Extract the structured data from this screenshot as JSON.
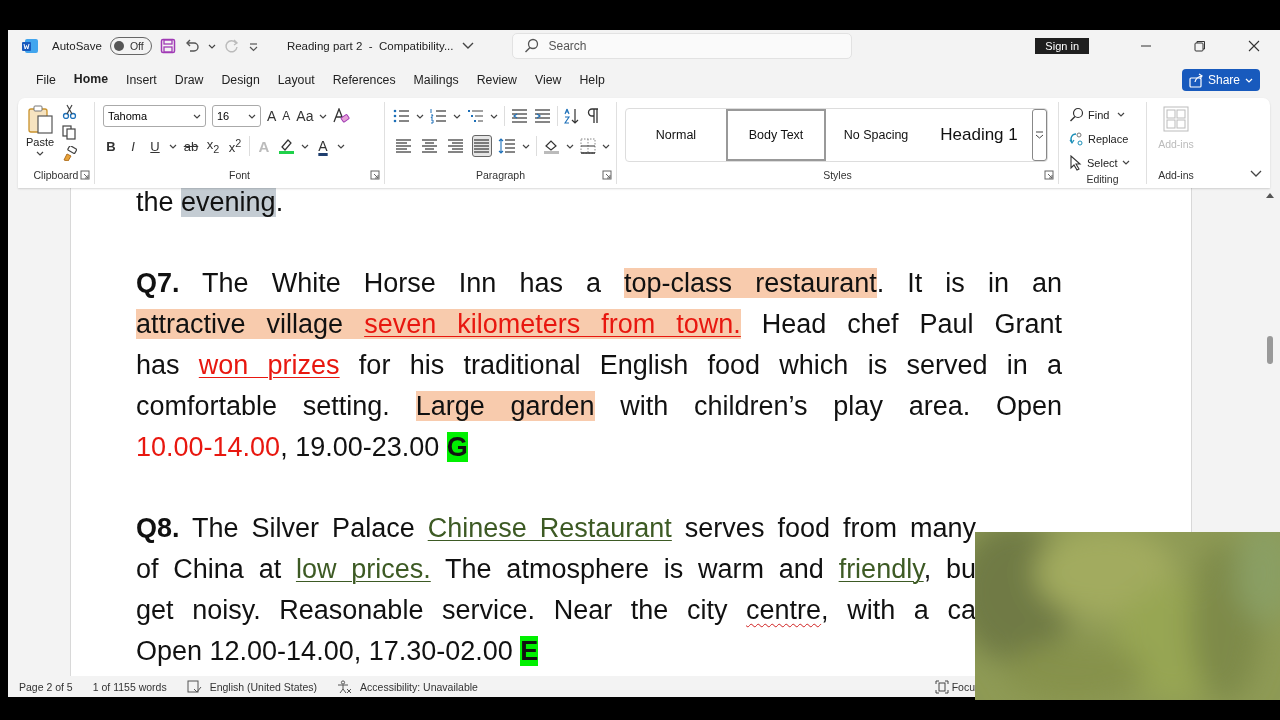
{
  "title_bar": {
    "autosave_label": "AutoSave",
    "autosave": {
      "label": "Off",
      "on": false
    },
    "document_title": "Reading part 2  -  Compatibility...",
    "search": {
      "placeholder": "Search"
    },
    "sign_in": "Sign in"
  },
  "menu_tabs": [
    {
      "label": "File",
      "selected": false
    },
    {
      "label": "Home",
      "selected": true
    },
    {
      "label": "Insert",
      "selected": false
    },
    {
      "label": "Draw",
      "selected": false
    },
    {
      "label": "Design",
      "selected": false
    },
    {
      "label": "Layout",
      "selected": false
    },
    {
      "label": "References",
      "selected": false
    },
    {
      "label": "Mailings",
      "selected": false
    },
    {
      "label": "Review",
      "selected": false
    },
    {
      "label": "View",
      "selected": false
    },
    {
      "label": "Help",
      "selected": false
    }
  ],
  "share": "Share",
  "ribbon": {
    "clipboard": {
      "paste": "Paste",
      "label": "Clipboard"
    },
    "font": {
      "font_name": "Tahoma",
      "font_size": "16",
      "grow": "A",
      "shrink": "A",
      "change_case": "Aa",
      "format_buttons": [
        "B",
        "I",
        "U",
        "ab",
        "x$_{2}$",
        "x$^{2}$"
      ],
      "text_effects": "A",
      "font_color": "A",
      "label": "Font"
    },
    "paragraph": {
      "alignments": [
        {
          "selected": false
        },
        {
          "selected": false
        },
        {
          "selected": false
        },
        {
          "selected": true
        }
      ],
      "label": "Paragraph"
    },
    "styles": {
      "items": [
        {
          "label": "Normal",
          "kind": "normal",
          "selected": false
        },
        {
          "label": "Body Text",
          "kind": "normal",
          "selected": true
        },
        {
          "label": "No Spacing",
          "kind": "normal",
          "selected": false
        },
        {
          "label": "Heading 1",
          "kind": "heading",
          "selected": false
        }
      ],
      "label": "Styles"
    },
    "editing": {
      "find": "Find",
      "replace": "Replace",
      "select": "Select",
      "label": "Editing"
    },
    "addins": {
      "button": {
        "label": "Add-ins",
        "disabled": true
      },
      "label": "Add-ins"
    }
  },
  "document": {
    "paragraphs": [
      {
        "lines": [
          [
            {
              "text": "the ",
              "kind": "plain"
            },
            {
              "text": "evening",
              "kind": "gray-highlight"
            },
            {
              "text": ".",
              "kind": "plain"
            }
          ]
        ]
      },
      {
        "lines": [
          [
            {
              "text": "Q7.",
              "kind": "bold"
            },
            {
              "text": " The White Horse Inn has a ",
              "kind": "plain"
            },
            {
              "text": "top-class restaurant",
              "kind": "highlight"
            },
            {
              "text": ". It is in an",
              "kind": "plain"
            }
          ],
          [
            {
              "text": "attractive village ",
              "kind": "highlight"
            },
            {
              "text": "seven kilometers from town.",
              "kind": "highlight-red-underline"
            },
            {
              "text": " Head chef Paul Grant",
              "kind": "plain"
            }
          ],
          [
            {
              "text": "has ",
              "kind": "plain"
            },
            {
              "text": "won prizes",
              "kind": "red-underline"
            },
            {
              "text": " for his traditional English food which is served in a",
              "kind": "plain"
            }
          ],
          [
            {
              "text": "comfortable setting. ",
              "kind": "plain"
            },
            {
              "text": "Large garden",
              "kind": "highlight"
            },
            {
              "text": " with children’s play area. Open",
              "kind": "plain"
            }
          ],
          [
            {
              "text": "10.00-14.00",
              "kind": "red"
            },
            {
              "text": ", 19.00-23.00 ",
              "kind": "plain"
            },
            {
              "text": "G",
              "kind": "answer"
            }
          ]
        ]
      },
      {
        "partly_covered": true,
        "lines": [
          [
            {
              "text": "Q8.",
              "kind": "bold"
            },
            {
              "text": " The Silver Palace ",
              "kind": "plain"
            },
            {
              "text": "Chinese Restaurant",
              "kind": "green-underline"
            },
            {
              "text": " serves food from many",
              "kind": "plain"
            }
          ],
          [
            {
              "text": "of China at ",
              "kind": "plain"
            },
            {
              "text": "low prices.",
              "kind": "green-underline"
            },
            {
              "text": " The atmosphere is warm and ",
              "kind": "plain"
            },
            {
              "text": "friendly",
              "kind": "green-underline"
            },
            {
              "text": ", bu",
              "kind": "plain"
            }
          ],
          [
            {
              "text": "get noisy. Reasonable service. Near the city ",
              "kind": "plain"
            },
            {
              "text": "centre",
              "kind": "spelling"
            },
            {
              "text": ", with a ca",
              "kind": "plain"
            }
          ],
          [
            {
              "text": "Open 12.00-14.00, 17.30-02.00 ",
              "kind": "plain"
            },
            {
              "text": "E",
              "kind": "answer"
            }
          ]
        ]
      }
    ]
  },
  "status_bar": {
    "page": "Page 2 of 5",
    "words": "1 of 1155 words",
    "language": "English (United States)",
    "accessibility": "Accessibility: Unavailable",
    "focus": "Focu"
  }
}
